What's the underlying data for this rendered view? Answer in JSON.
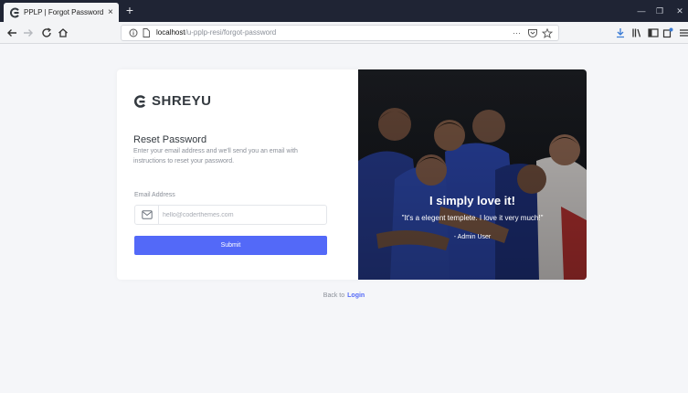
{
  "browser": {
    "tab_title": "PPLP | Forgot Password",
    "tab_close": "×",
    "new_tab": "+",
    "url_host": "localhost",
    "url_path": "/u-pplp-resi/forgot-password",
    "url_more": "···"
  },
  "brand": {
    "name": "SHREYU",
    "logo_icon": "shreyu-logo-icon"
  },
  "form": {
    "heading": "Reset Password",
    "description": "Enter your email address and we'll send you an email with instructions to reset your password.",
    "email_label": "Email Address",
    "email_placeholder": "hello@coderthemes.com",
    "email_value": "",
    "submit_label": "Submit"
  },
  "testimonial": {
    "title": "I simply love it!",
    "quote": "\"It's a elegent templete. I love it very much!\"",
    "author": "- Admin User"
  },
  "footer": {
    "back_text": "Back to",
    "login_link": "Login"
  },
  "colors": {
    "primary": "#5369f8",
    "browser_dark": "#1f2434",
    "page_bg": "#f5f6f9"
  }
}
